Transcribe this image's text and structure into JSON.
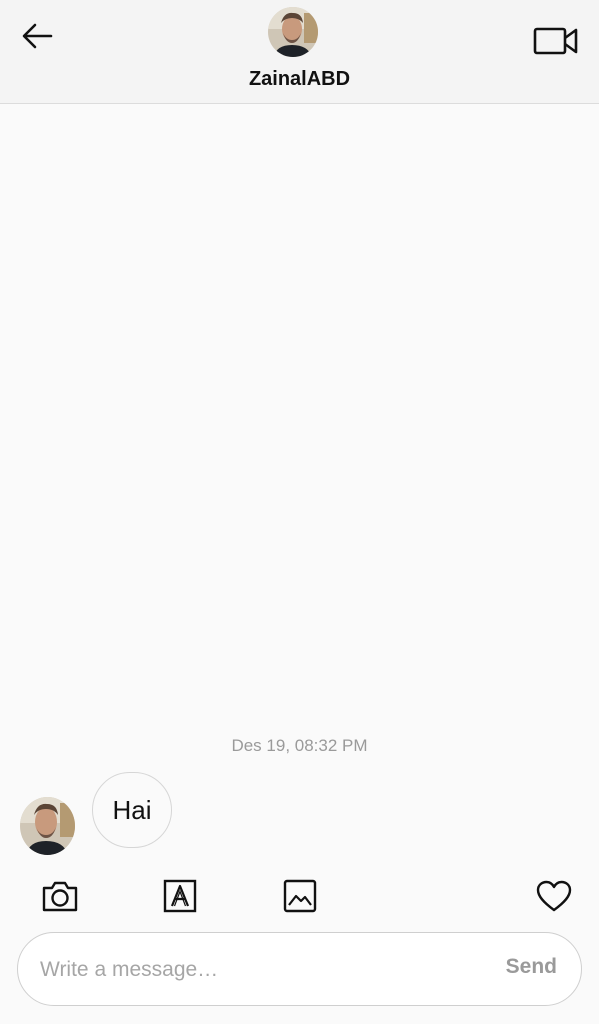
{
  "header": {
    "back_icon": "arrow-left-icon",
    "username": "ZainalABD",
    "video_call_icon": "video-camera-icon"
  },
  "chat": {
    "timestamp": "Des 19, 08:32 PM",
    "messages": [
      {
        "sender": "ZainalABD",
        "text": "Hai"
      }
    ]
  },
  "toolbar": {
    "camera_icon": "camera-icon",
    "text_icon": "text-style-icon",
    "gallery_icon": "gallery-icon",
    "like_icon": "heart-icon"
  },
  "composer": {
    "placeholder": "Write a message…",
    "value": "",
    "send_label": "Send"
  },
  "colors": {
    "background": "#fafafa",
    "header_background": "#f4f4f4",
    "muted_text": "#9a9a9a",
    "border": "#d6d6d6"
  }
}
